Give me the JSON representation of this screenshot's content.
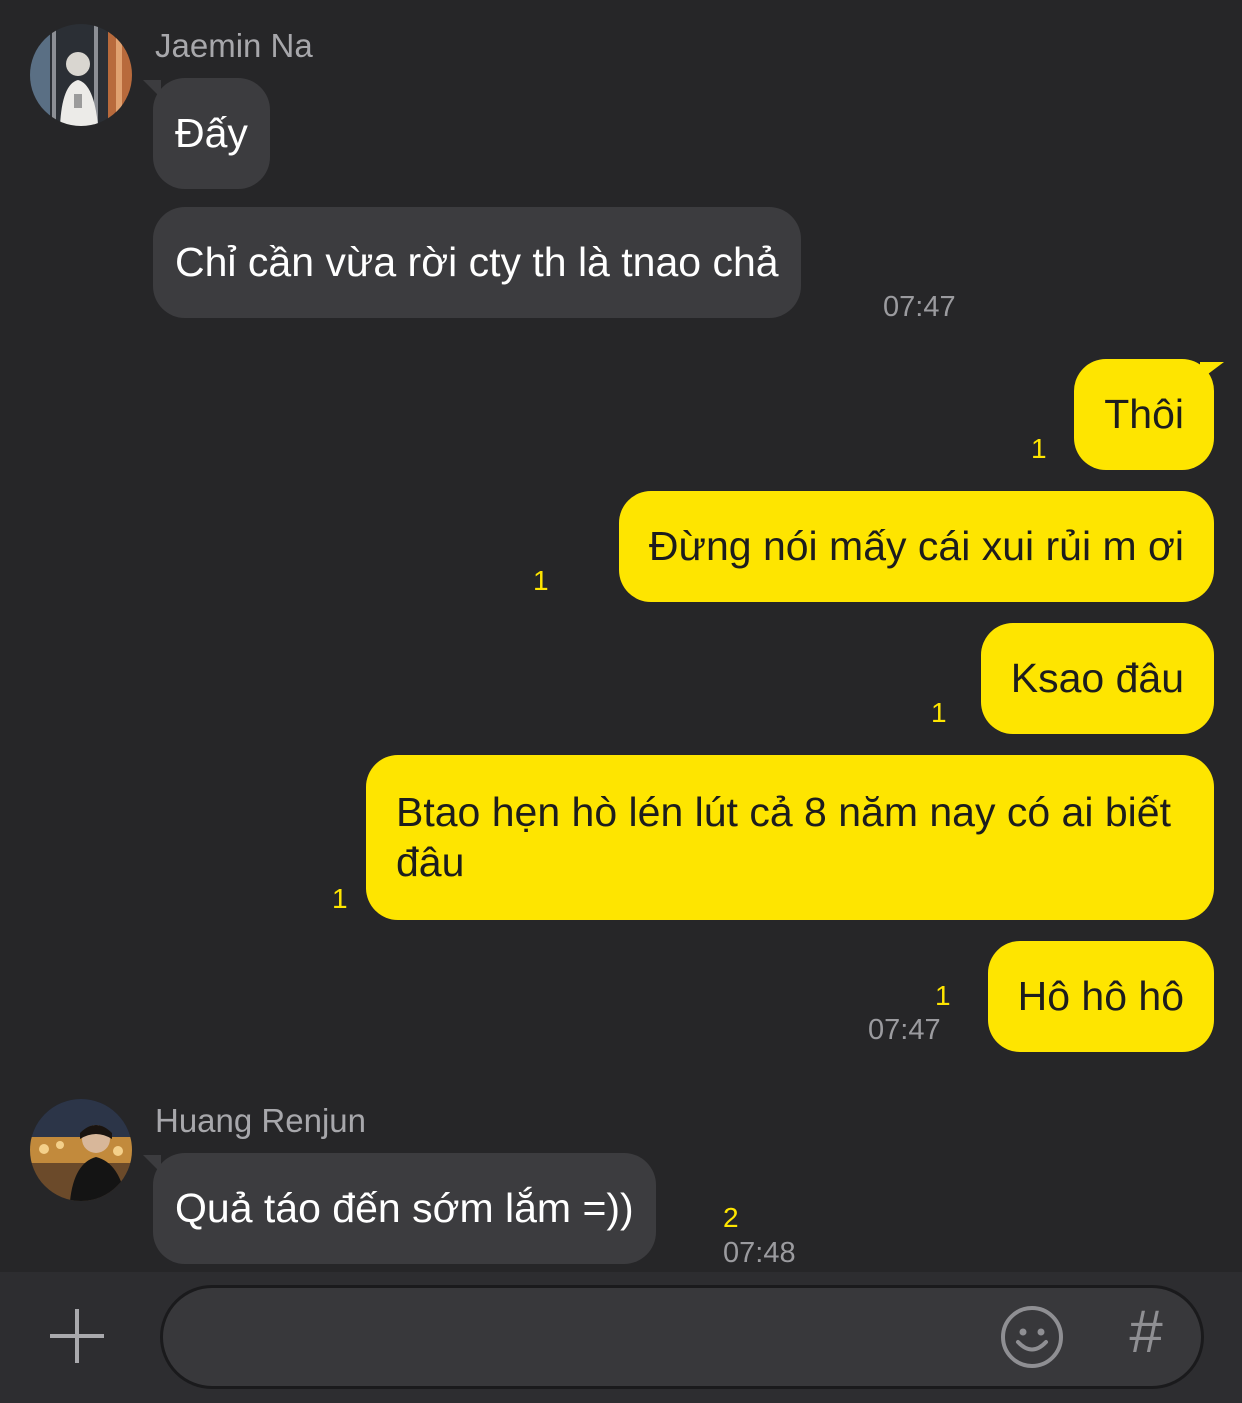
{
  "colors": {
    "background": "#262628",
    "incoming_bubble": "#3c3c3f",
    "outgoing_bubble": "#fee500",
    "unread_count": "#fee500"
  },
  "messages": [
    {
      "sender": "Jaemin Na",
      "text": "Đấy",
      "avatar": "avatar-jaemin"
    },
    {
      "sender": "Jaemin Na",
      "text": "Chỉ cần vừa rời cty th là tnao chả",
      "time": "07:47"
    },
    {
      "text": "Thôi",
      "unread": "1",
      "outgoing": true
    },
    {
      "text": "Đừng nói mấy cái xui rủi m ơi",
      "unread": "1",
      "outgoing": true
    },
    {
      "text": "Ksao đâu",
      "unread": "1",
      "outgoing": true
    },
    {
      "text": "Btao hẹn hò lén lút cả 8 năm nay có ai biết đâu",
      "unread": "1",
      "outgoing": true
    },
    {
      "text": "Hô hô hô",
      "unread": "1",
      "time": "07:47",
      "outgoing": true
    },
    {
      "sender": "Huang Renjun",
      "text": "Quả táo đến sớm lắm =))",
      "unread": "2",
      "time": "07:48",
      "avatar": "avatar-renjun"
    }
  ],
  "composer": {
    "add_icon": "plus-icon",
    "emoji_icon": "smiley-icon",
    "hashtag_icon": "hash-icon",
    "hashtag_label": "#",
    "input_value": ""
  }
}
